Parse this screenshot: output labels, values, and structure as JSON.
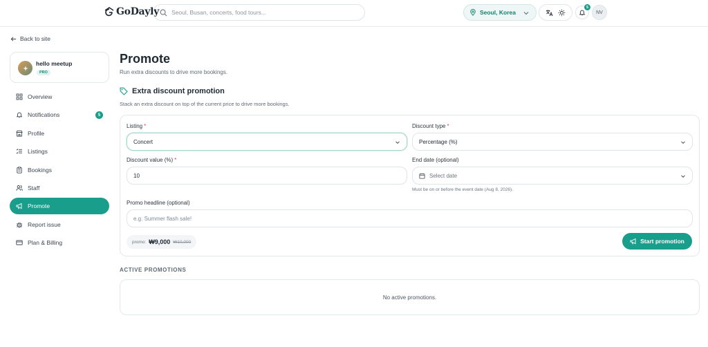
{
  "header": {
    "logo_text": "GoDayly",
    "search_placeholder": "Seoul, Busan, concerts, food tours...",
    "location": "Seoul, Korea",
    "notification_count": "5",
    "avatar_initials": "NV"
  },
  "sidebar": {
    "back_label": "Back to site",
    "profile": {
      "name": "hello meetup",
      "badge": "PRO"
    },
    "items": [
      {
        "label": "Overview",
        "icon": "grid-icon"
      },
      {
        "label": "Notifications",
        "icon": "bell-icon",
        "count": "5"
      },
      {
        "label": "Profile",
        "icon": "store-icon"
      },
      {
        "label": "Listings",
        "icon": "list-icon"
      },
      {
        "label": "Bookings",
        "icon": "clipboard-icon"
      },
      {
        "label": "Staff",
        "icon": "users-icon"
      },
      {
        "label": "Promote",
        "icon": "megaphone-icon",
        "active": true
      },
      {
        "label": "Report issue",
        "icon": "bug-icon"
      },
      {
        "label": "Plan & Billing",
        "icon": "card-icon"
      }
    ]
  },
  "main": {
    "title": "Promote",
    "subtitle": "Run extra discounts to drive more bookings.",
    "section_title": "Extra discount promotion",
    "section_subtitle": "Stack an extra discount on top of the current price to drive more bookings.",
    "form": {
      "listing_label": "Listing",
      "listing_value": "Concert",
      "discount_type_label": "Discount type",
      "discount_type_value": "Percentage (%)",
      "discount_value_label": "Discount value (%)",
      "discount_value": "10",
      "end_date_label": "End date (optional)",
      "end_date_placeholder": "Select date",
      "end_date_hint": "Must be on or before the event date (Aug 8, 2026).",
      "headline_label": "Promo headline (optional)",
      "headline_placeholder": "e.g. Summer flash sale!",
      "required_mark": "*",
      "price_label": "promo:",
      "price_now": "₩9,000",
      "price_was": "₩10,000",
      "submit_label": "Start promotion"
    },
    "active_title": "ACTIVE PROMOTIONS",
    "active_empty": "No active promotions."
  },
  "colors": {
    "accent": "#1a9e8c",
    "required": "#e0474c"
  }
}
